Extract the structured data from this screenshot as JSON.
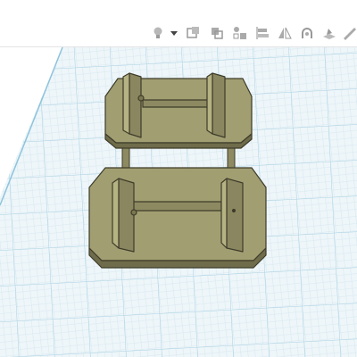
{
  "app": {
    "toolbar": {
      "buttons": [
        {
          "name": "light-bulb-icon",
          "state": "active"
        },
        {
          "name": "dropdown-caret-icon"
        },
        {
          "name": "show-all-icon"
        },
        {
          "name": "group-icon"
        },
        {
          "name": "ungroup-icon"
        },
        {
          "name": "align-icon"
        },
        {
          "name": "mirror-icon"
        },
        {
          "name": "cruise-icon"
        },
        {
          "name": "workplane-icon"
        },
        {
          "name": "ruler-icon"
        }
      ]
    },
    "workplane": {
      "grid_color": "#cfe4ee",
      "grid_major_color": "#9ccbe0",
      "background": "#e9f3f7",
      "edge_color": "#7fb8d6"
    },
    "model": {
      "fill_top": "#9d9a6e",
      "fill_side": "#787552",
      "outline": "#3e3c2a",
      "parts": [
        "rear-bracket",
        "front-bracket",
        "connector-rods"
      ]
    }
  }
}
